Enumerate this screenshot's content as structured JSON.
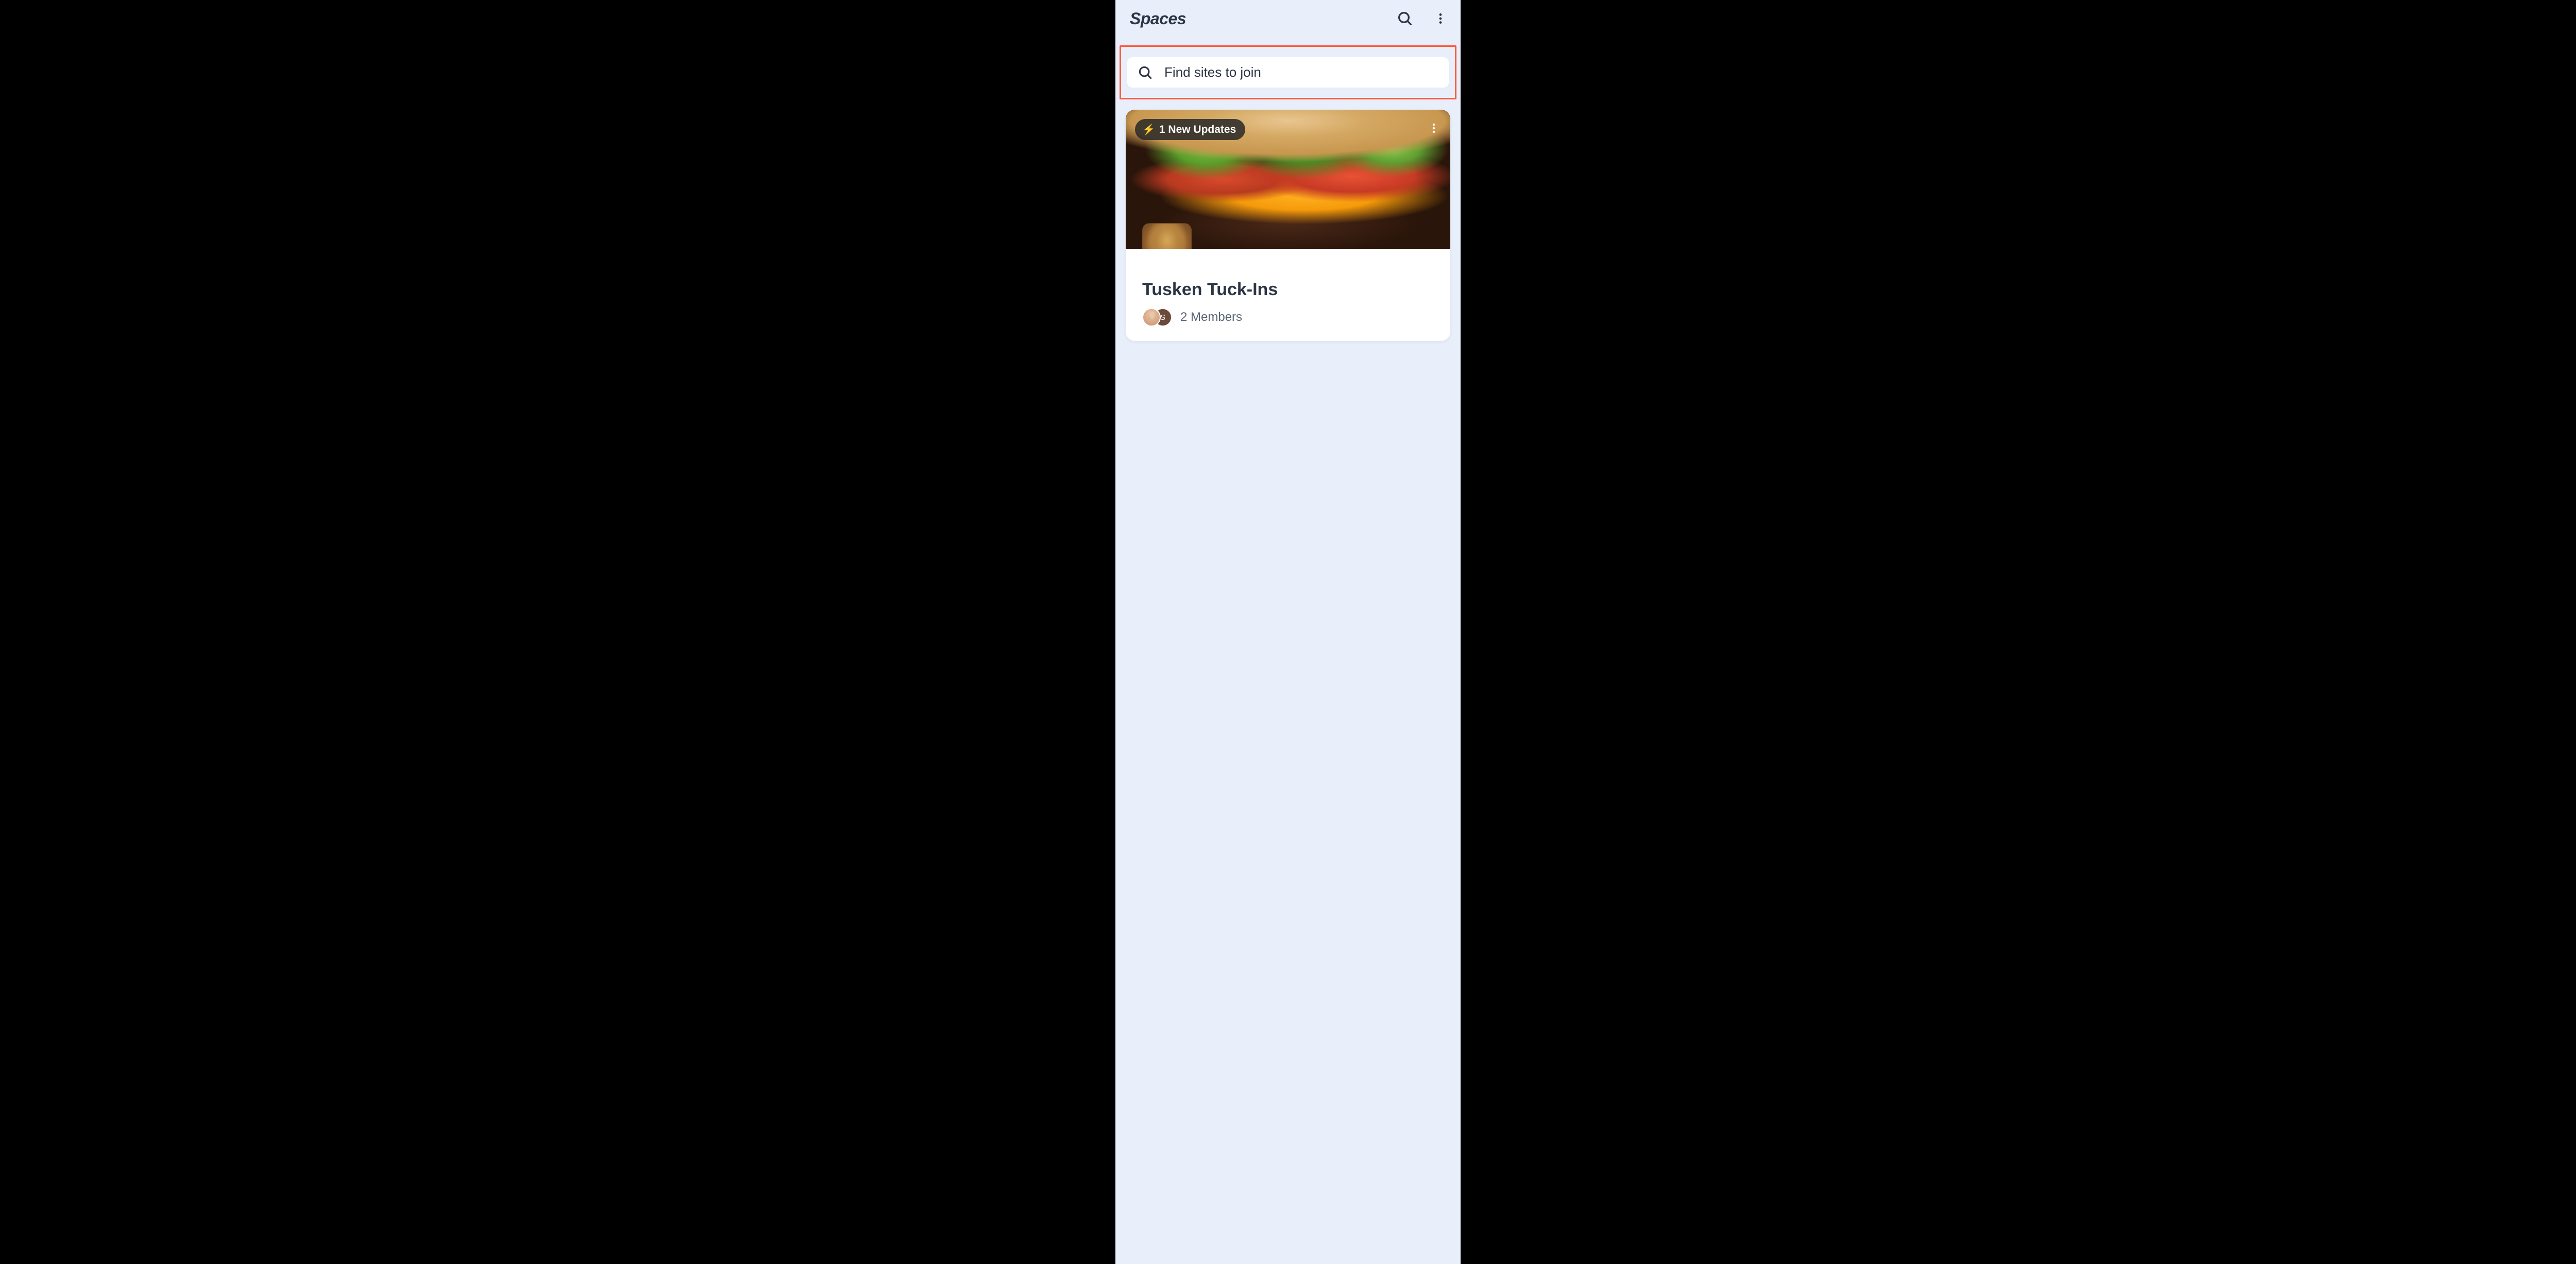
{
  "header": {
    "title": "Spaces"
  },
  "search": {
    "placeholder": "Find sites to join"
  },
  "card": {
    "updates_count": "1 New Updates",
    "bolt_emoji": "⚡",
    "title": "Tusken Tuck-Ins",
    "member_count": "2 Members",
    "avatar_initial_2": "S"
  }
}
